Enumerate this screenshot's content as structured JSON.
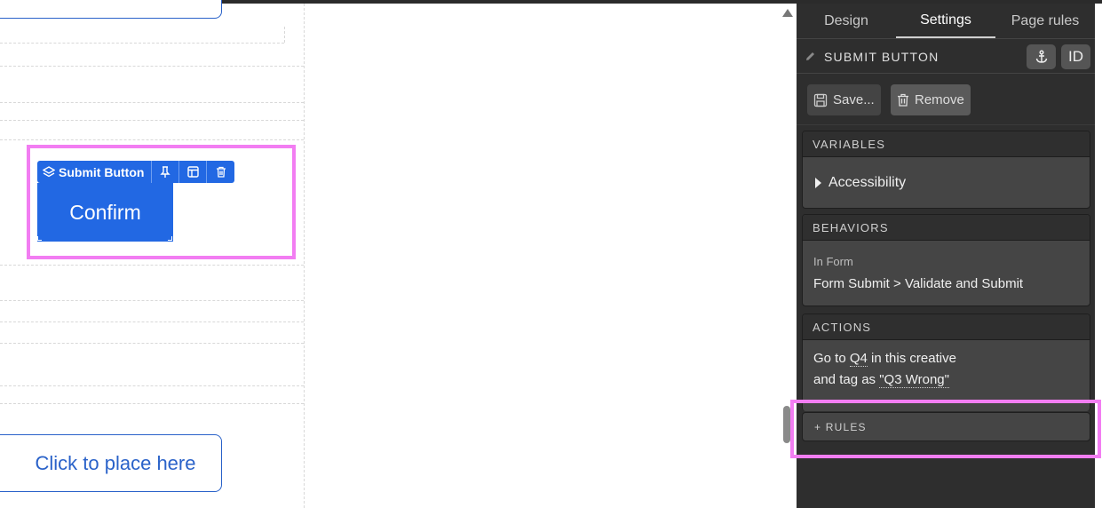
{
  "canvas": {
    "selected_element": {
      "toolbar_label": "Submit Button",
      "button_text": "Confirm"
    },
    "placeholder_button_text": "Click to place here"
  },
  "panel": {
    "tabs": [
      {
        "label": "Design",
        "active": false
      },
      {
        "label": "Settings",
        "active": true
      },
      {
        "label": "Page rules",
        "active": false
      }
    ],
    "element_title": "SUBMIT BUTTON",
    "id_button_label": "ID",
    "save_label": "Save...",
    "remove_label": "Remove",
    "variables": {
      "heading": "VARIABLES",
      "item": "Accessibility"
    },
    "behaviors": {
      "heading": "BEHAVIORS",
      "context": "In Form",
      "value": "Form Submit > Validate and Submit"
    },
    "actions": {
      "heading": "ACTIONS",
      "line1_prefix": "Go to ",
      "line1_link": "Q4",
      "line1_suffix": " in this creative",
      "line2_prefix": "and tag as ",
      "line2_link": "\"Q3 Wrong\""
    },
    "rules_label": "+ RULES"
  },
  "colors": {
    "accent_blue": "#2268e3",
    "highlight_pink": "#f27df2",
    "panel_bg": "#2e2e2e"
  },
  "icons": {
    "toolbar": [
      "layers-icon",
      "pin-icon",
      "layout-icon",
      "trash-icon"
    ],
    "header": [
      "pencil-icon",
      "anchor-icon"
    ],
    "actions": [
      "save-icon",
      "trash-icon"
    ],
    "variables": "caret-right-icon",
    "scroll": "scroll-up-arrow-icon"
  }
}
